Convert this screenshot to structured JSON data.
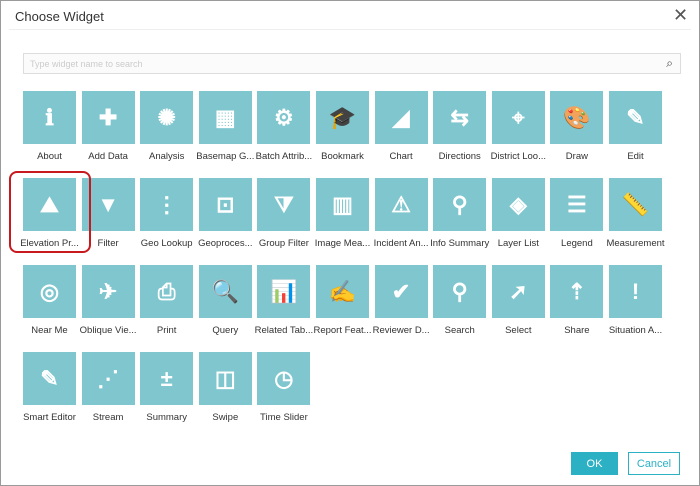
{
  "dialog": {
    "title": "Choose Widget",
    "close_icon": "close-icon"
  },
  "search": {
    "placeholder": "Type widget name to search",
    "value": ""
  },
  "colors": {
    "tile": "#7fc6ce",
    "accent": "#2bb0c4",
    "highlight": "#c8191f"
  },
  "widgets": [
    {
      "label": "About",
      "icon": "ℹ"
    },
    {
      "label": "Add Data",
      "icon": "✚"
    },
    {
      "label": "Analysis",
      "icon": "✺"
    },
    {
      "label": "Basemap G...",
      "icon": "▦"
    },
    {
      "label": "Batch Attrib...",
      "icon": "⚙"
    },
    {
      "label": "Bookmark",
      "icon": "🎓"
    },
    {
      "label": "Chart",
      "icon": "◢"
    },
    {
      "label": "Directions",
      "icon": "⇆"
    },
    {
      "label": "District Loo...",
      "icon": "⌖"
    },
    {
      "label": "Draw",
      "icon": "🎨"
    },
    {
      "label": "Edit",
      "icon": "✎"
    },
    {
      "label": "Elevation Pr...",
      "icon": "⛰"
    },
    {
      "label": "Filter",
      "icon": "▼"
    },
    {
      "label": "Geo Lookup",
      "icon": "⋮"
    },
    {
      "label": "Geoproces...",
      "icon": "⊡"
    },
    {
      "label": "Group Filter",
      "icon": "⧩"
    },
    {
      "label": "Image Mea...",
      "icon": "▥"
    },
    {
      "label": "Incident An...",
      "icon": "⚠"
    },
    {
      "label": "Info Summary",
      "icon": "⚲"
    },
    {
      "label": "Layer List",
      "icon": "◈"
    },
    {
      "label": "Legend",
      "icon": "☰"
    },
    {
      "label": "Measurement",
      "icon": "📏"
    },
    {
      "label": "Near Me",
      "icon": "◎"
    },
    {
      "label": "Oblique Vie...",
      "icon": "✈"
    },
    {
      "label": "Print",
      "icon": "⎙"
    },
    {
      "label": "Query",
      "icon": "🔍"
    },
    {
      "label": "Related Tab...",
      "icon": "📊"
    },
    {
      "label": "Report Feat...",
      "icon": "✍"
    },
    {
      "label": "Reviewer D...",
      "icon": "✔"
    },
    {
      "label": "Search",
      "icon": "⚲"
    },
    {
      "label": "Select",
      "icon": "➚"
    },
    {
      "label": "Share",
      "icon": "⇡"
    },
    {
      "label": "Situation A...",
      "icon": "!"
    },
    {
      "label": "Smart Editor",
      "icon": "✎"
    },
    {
      "label": "Stream",
      "icon": "⋰"
    },
    {
      "label": "Summary",
      "icon": "±"
    },
    {
      "label": "Swipe",
      "icon": "◫"
    },
    {
      "label": "Time Slider",
      "icon": "◷"
    }
  ],
  "selected": "Elevation Pr...",
  "buttons": {
    "ok": "OK",
    "cancel": "Cancel"
  }
}
